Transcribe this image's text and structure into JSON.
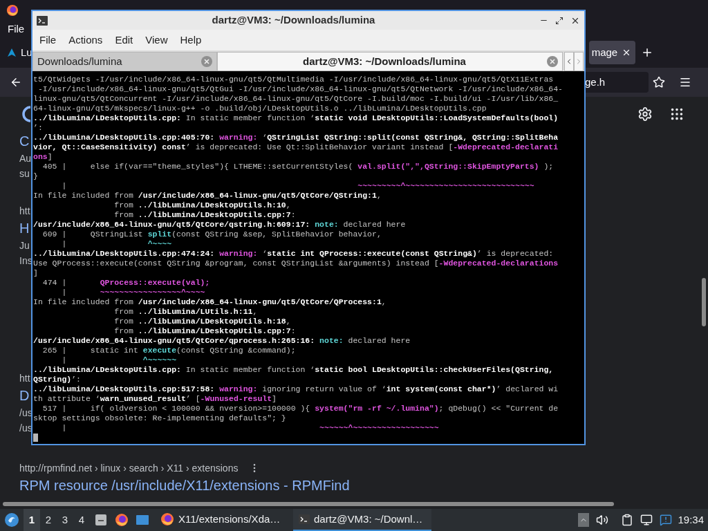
{
  "browser": {
    "menu": [
      "File"
    ],
    "tabs": [
      {
        "label": "Lu",
        "selected": false
      },
      {
        "label": "mage",
        "selected": true
      }
    ],
    "address": "ge.h",
    "results": [
      {
        "items": [
          {
            "kind": "title",
            "text": "C"
          },
          {
            "kind": "snippet",
            "text": "Au"
          },
          {
            "kind": "snippet",
            "text": "su"
          }
        ]
      },
      {
        "items": [
          {
            "kind": "url",
            "text": "htt"
          },
          {
            "kind": "title",
            "text": "H"
          },
          {
            "kind": "snippet",
            "text": "Ju"
          },
          {
            "kind": "snippet",
            "text": "Ins"
          }
        ]
      },
      {
        "items": [
          {
            "kind": "url",
            "text": "htt"
          },
          {
            "kind": "title",
            "text": "D"
          },
          {
            "kind": "snippet",
            "text": "/us"
          },
          {
            "kind": "snippet",
            "text": "/us"
          }
        ]
      },
      {
        "items": [
          {
            "kind": "url",
            "text": "http://rpmfind.net › linux › search › X11 › extensions"
          },
          {
            "kind": "title",
            "text": "RPM resource /usr/include/X11/extensions - RPMFind"
          }
        ]
      }
    ]
  },
  "terminal": {
    "title": "dartz@VM3: ~/Downloads/lumina",
    "menu": [
      "File",
      "Actions",
      "Edit",
      "View",
      "Help"
    ],
    "tabs": [
      {
        "label": "Downloads/lumina",
        "selected": false
      },
      {
        "label": "dartz@VM3: ~/Downloads/lumina",
        "selected": true
      }
    ],
    "lines": [
      [
        {
          "kind": "plain",
          "text": "t5/QtWidgets -I/usr/include/x86_64-linux-gnu/qt5/QtMultimedia -I/usr/include/x86_64-linux-gnu/qt5/QtX11Extras"
        }
      ],
      [
        {
          "kind": "plain",
          "text": " -I/usr/include/x86_64-linux-gnu/qt5/QtGui -I/usr/include/x86_64-linux-gnu/qt5/QtNetwork -I/usr/include/x86_64-"
        }
      ],
      [
        {
          "kind": "plain",
          "text": "linux-gnu/qt5/QtConcurrent -I/usr/include/x86_64-linux-gnu/qt5/QtCore -I.build/moc -I.build/ui -I/usr/lib/x86_"
        }
      ],
      [
        {
          "kind": "plain",
          "text": "64-linux-gnu/qt5/mkspecs/linux-g++ -o .build/obj/LDesktopUtils.o ../libLumina/LDesktopUtils.cpp"
        }
      ],
      [
        {
          "kind": "bold",
          "text": "../libLumina/LDesktopUtils.cpp:"
        },
        {
          "kind": "plain",
          "text": " In static member function ‘"
        },
        {
          "kind": "bold",
          "text": "static void LDesktopUtils::LoadSystemDefaults(bool)"
        }
      ],
      [
        {
          "kind": "plain",
          "text": "’:"
        }
      ],
      [
        {
          "kind": "bold",
          "text": "../libLumina/LDesktopUtils.cpp:405:70: "
        },
        {
          "kind": "magenta",
          "text": "warning: "
        },
        {
          "kind": "plain",
          "text": "‘"
        },
        {
          "kind": "bold",
          "text": "QStringList QString::split(const QString&, QString::SplitBeha"
        }
      ],
      [
        {
          "kind": "bold",
          "text": "vior, Qt::CaseSensitivity) const"
        },
        {
          "kind": "plain",
          "text": "’ is deprecated: Use Qt::SplitBehavior variant instead ["
        },
        {
          "kind": "magenta",
          "text": "-Wdeprecated-declarati"
        }
      ],
      [
        {
          "kind": "magenta",
          "text": "ons"
        },
        {
          "kind": "plain",
          "text": "]"
        }
      ],
      [
        {
          "kind": "plain",
          "text": "  405 |     else if(var==\"theme_styles\"){ LTHEME::setCurrentStyles( "
        },
        {
          "kind": "magenta",
          "text": "val.split(\",\",QString::SkipEmptyParts)"
        },
        {
          "kind": "plain",
          "text": " );"
        }
      ],
      [
        {
          "kind": "plain",
          "text": "}"
        }
      ],
      [
        {
          "kind": "plain",
          "text": "      |                                                             "
        },
        {
          "kind": "magenta",
          "text": "~~~~~~~~~^~~~~~~~~~~~~~~~~~~~~~~~~~~~"
        }
      ],
      [
        {
          "kind": "plain",
          "text": "In file included from "
        },
        {
          "kind": "bold",
          "text": "/usr/include/x86_64-linux-gnu/qt5/QtCore/QString:1"
        },
        {
          "kind": "plain",
          "text": ","
        }
      ],
      [
        {
          "kind": "plain",
          "text": "                 from "
        },
        {
          "kind": "bold",
          "text": "../libLumina/LDesktopUtils.h:10"
        },
        {
          "kind": "plain",
          "text": ","
        }
      ],
      [
        {
          "kind": "plain",
          "text": "                 from "
        },
        {
          "kind": "bold",
          "text": "../libLumina/LDesktopUtils.cpp:7"
        },
        {
          "kind": "plain",
          "text": ":"
        }
      ],
      [
        {
          "kind": "bold",
          "text": "/usr/include/x86_64-linux-gnu/qt5/QtCore/qstring.h:609:17: "
        },
        {
          "kind": "cyan",
          "text": "note: "
        },
        {
          "kind": "plain",
          "text": "declared here"
        }
      ],
      [
        {
          "kind": "plain",
          "text": "  609 |     QStringList "
        },
        {
          "kind": "cyan",
          "text": "split"
        },
        {
          "kind": "plain",
          "text": "(const QString &sep, SplitBehavior behavior,"
        }
      ],
      [
        {
          "kind": "plain",
          "text": "      |                 "
        },
        {
          "kind": "cyan",
          "text": "^~~~~"
        }
      ],
      [
        {
          "kind": "bold",
          "text": "../libLumina/LDesktopUtils.cpp:474:24: "
        },
        {
          "kind": "magenta",
          "text": "warning: "
        },
        {
          "kind": "plain",
          "text": "‘"
        },
        {
          "kind": "bold",
          "text": "static int QProcess::execute(const QString&)"
        },
        {
          "kind": "plain",
          "text": "’ is deprecated:"
        }
      ],
      [
        {
          "kind": "plain",
          "text": "Use QProcess::execute(const QString &program, const QStringList &arguments) instead ["
        },
        {
          "kind": "magenta",
          "text": "-Wdeprecated-declarations"
        }
      ],
      [
        {
          "kind": "plain",
          "text": "]"
        }
      ],
      [
        {
          "kind": "plain",
          "text": "  474 |       "
        },
        {
          "kind": "magenta",
          "text": "QProcess::execute(val);"
        }
      ],
      [
        {
          "kind": "plain",
          "text": "      |       "
        },
        {
          "kind": "magenta",
          "text": "~~~~~~~~~~~~~~~~~^~~~~"
        }
      ],
      [
        {
          "kind": "plain",
          "text": "In file included from "
        },
        {
          "kind": "bold",
          "text": "/usr/include/x86_64-linux-gnu/qt5/QtCore/QProcess:1"
        },
        {
          "kind": "plain",
          "text": ","
        }
      ],
      [
        {
          "kind": "plain",
          "text": "                 from "
        },
        {
          "kind": "bold",
          "text": "../libLumina/LUtils.h:11"
        },
        {
          "kind": "plain",
          "text": ","
        }
      ],
      [
        {
          "kind": "plain",
          "text": "                 from "
        },
        {
          "kind": "bold",
          "text": "../libLumina/LDesktopUtils.h:18"
        },
        {
          "kind": "plain",
          "text": ","
        }
      ],
      [
        {
          "kind": "plain",
          "text": "                 from "
        },
        {
          "kind": "bold",
          "text": "../libLumina/LDesktopUtils.cpp:7"
        },
        {
          "kind": "plain",
          "text": ":"
        }
      ],
      [
        {
          "kind": "bold",
          "text": "/usr/include/x86_64-linux-gnu/qt5/QtCore/qprocess.h:265:16: "
        },
        {
          "kind": "cyan",
          "text": "note: "
        },
        {
          "kind": "plain",
          "text": "declared here"
        }
      ],
      [
        {
          "kind": "plain",
          "text": "  265 |     static int "
        },
        {
          "kind": "cyan",
          "text": "execute"
        },
        {
          "kind": "plain",
          "text": "(const QString &command);"
        }
      ],
      [
        {
          "kind": "plain",
          "text": "      |                "
        },
        {
          "kind": "cyan",
          "text": "^~~~~~~"
        }
      ],
      [
        {
          "kind": "bold",
          "text": "../libLumina/LDesktopUtils.cpp:"
        },
        {
          "kind": "plain",
          "text": " In static member function ‘"
        },
        {
          "kind": "bold",
          "text": "static bool LDesktopUtils::checkUserFiles(QString,"
        }
      ],
      [
        {
          "kind": "bold",
          "text": "QString)"
        },
        {
          "kind": "plain",
          "text": "’:"
        }
      ],
      [
        {
          "kind": "bold",
          "text": "../libLumina/LDesktopUtils.cpp:517:58: "
        },
        {
          "kind": "magenta",
          "text": "warning: "
        },
        {
          "kind": "plain",
          "text": "ignoring return value of ‘"
        },
        {
          "kind": "bold",
          "text": "int system(const char*)"
        },
        {
          "kind": "plain",
          "text": "’ declared wi"
        }
      ],
      [
        {
          "kind": "plain",
          "text": "th attribute ‘"
        },
        {
          "kind": "bold",
          "text": "warn_unused_result"
        },
        {
          "kind": "plain",
          "text": "’ ["
        },
        {
          "kind": "magenta",
          "text": "-Wunused-result"
        },
        {
          "kind": "plain",
          "text": "]"
        }
      ],
      [
        {
          "kind": "plain",
          "text": "  517 |     if( oldversion < 100000 && nversion>=100000 ){ "
        },
        {
          "kind": "magenta",
          "text": "system(\"rm -rf ~/.lumina\")"
        },
        {
          "kind": "plain",
          "text": "; qDebug() << \"Current de"
        }
      ],
      [
        {
          "kind": "plain",
          "text": "sktop settings obsolete: Re-implementing defaults\"; }"
        }
      ],
      [
        {
          "kind": "plain",
          "text": "      |                                                     "
        },
        {
          "kind": "magenta",
          "text": "~~~~~~^~~~~~~~~~~~~~~~~~~"
        }
      ]
    ]
  },
  "taskbar": {
    "workspaces": [
      {
        "label": "1",
        "selected": true
      },
      {
        "label": "2",
        "selected": false
      },
      {
        "label": "3",
        "selected": false
      },
      {
        "label": "4",
        "selected": false
      }
    ],
    "tasks": [
      {
        "kind": "browser",
        "label": "X11/extensions/Xda…",
        "selected": false
      },
      {
        "kind": "terminal",
        "label": "dartz@VM3: ~/Downl…",
        "selected": true
      }
    ],
    "clock": "19:34"
  }
}
